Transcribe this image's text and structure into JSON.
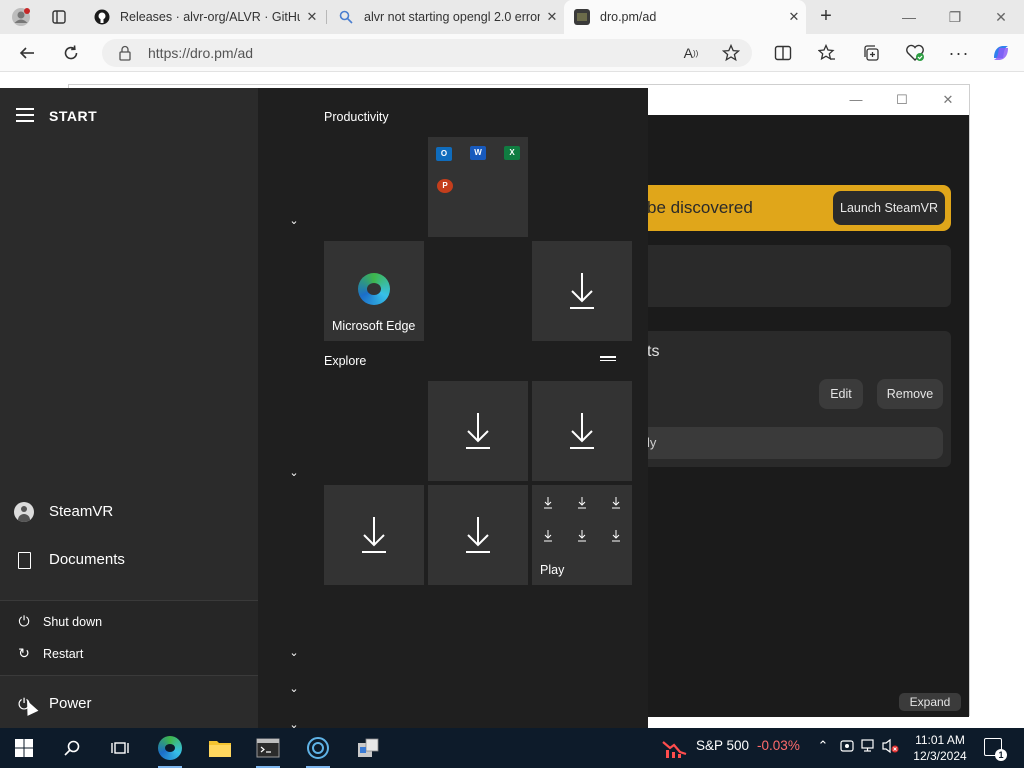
{
  "browser": {
    "tabs": [
      {
        "title": "Releases · alvr-org/ALVR · GitHub",
        "favicon": "github-icon",
        "active": false
      },
      {
        "title": "alvr not starting opengl 2.0 error",
        "favicon": "search-icon",
        "active": false
      },
      {
        "title": "dro.pm/ad",
        "favicon": "page-icon",
        "active": true
      }
    ],
    "address_url": "https://dro.pm/ad"
  },
  "app_window": {
    "banner_text": "be discovered",
    "launch_button": "Launch SteamVR",
    "panel_title": "ts",
    "edit_button": "Edit",
    "remove_button": "Remove",
    "bar_text": "ly",
    "expand_button": "Expand",
    "banner_color": "#e0a61a"
  },
  "start_menu": {
    "title": "START",
    "user_label": "SteamVR",
    "documents_label": "Documents",
    "power_menu": {
      "shutdown": "Shut down",
      "restart": "Restart"
    },
    "power_label": "Power",
    "groups": {
      "productivity": "Productivity",
      "explore": "Explore"
    },
    "tiles": {
      "edge_label": "Microsoft Edge",
      "play_label": "Play"
    },
    "office_minis": [
      "O",
      "W",
      "X",
      "P"
    ]
  },
  "taskbar": {
    "stock_name": "S&P 500",
    "stock_change": "-0.03%",
    "time": "11:01 AM",
    "date": "12/3/2024",
    "notification_count": "1"
  }
}
